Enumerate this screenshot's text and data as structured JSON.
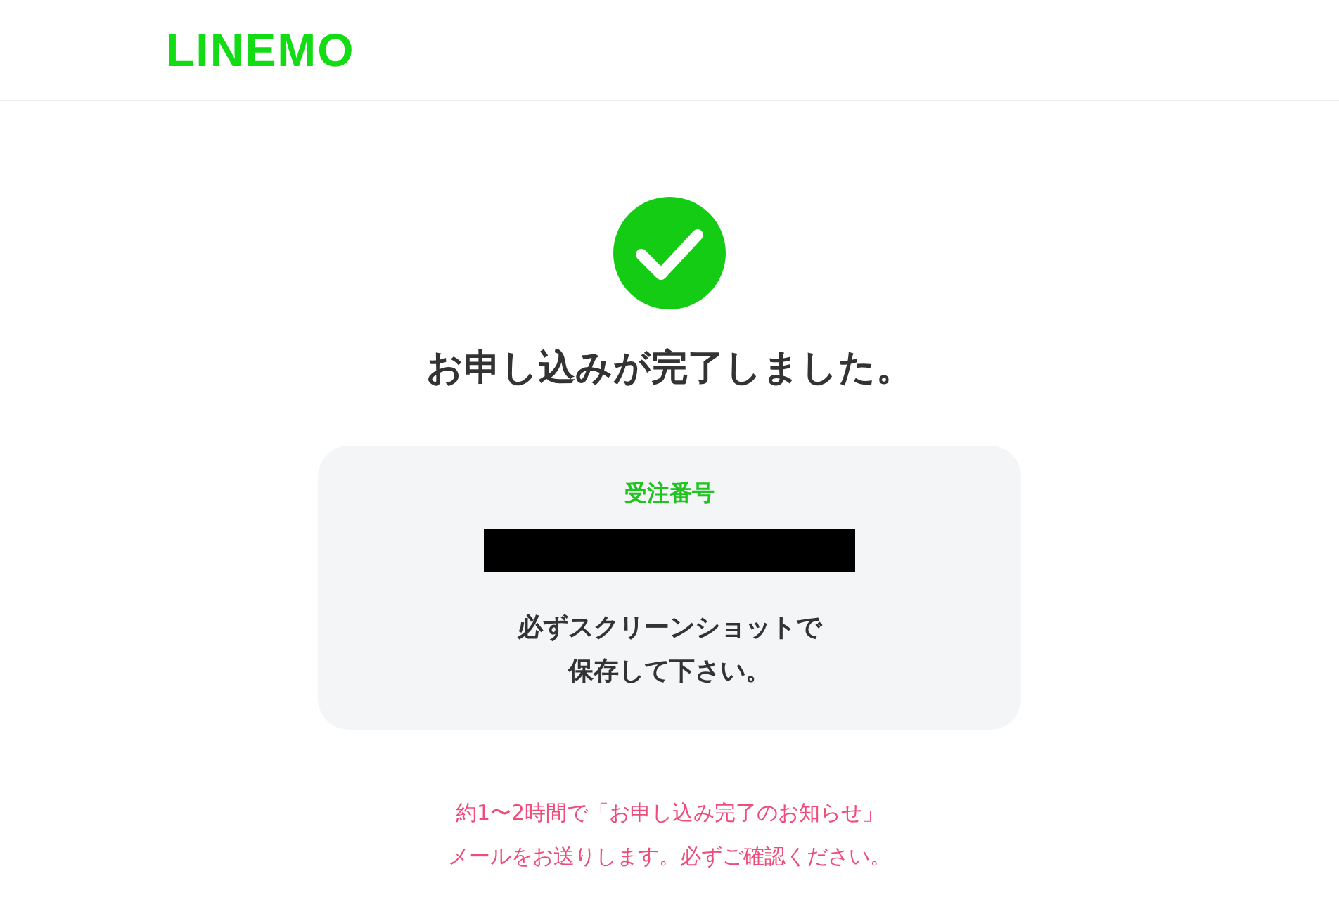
{
  "header": {
    "logo": "LINEMO"
  },
  "status": {
    "kind": "success",
    "title": "お申し込みが完了しました。"
  },
  "order_card": {
    "label": "受注番号",
    "number_redacted": true,
    "note_lines": [
      "必ずスクリーンショットで",
      "保存して下さい。"
    ]
  },
  "notice_lines": [
    "約1〜2時間で「お申し込み完了のお知らせ」",
    "メールをお送りします。必ずご確認ください。"
  ]
}
